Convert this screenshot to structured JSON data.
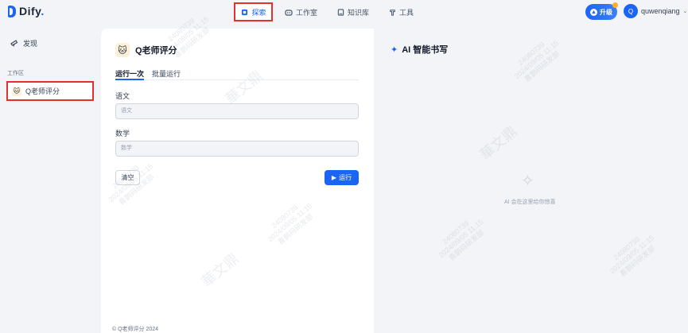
{
  "brand": {
    "name": "Dify",
    "dot": "."
  },
  "nav": [
    {
      "label": "探索",
      "icon": "compass-icon",
      "active": true
    },
    {
      "label": "工作室",
      "icon": "robot-icon",
      "active": false
    },
    {
      "label": "知识库",
      "icon": "book-icon",
      "active": false
    },
    {
      "label": "工具",
      "icon": "tool-icon",
      "active": false
    }
  ],
  "upgrade": {
    "label": "升级"
  },
  "user": {
    "initial": "Q",
    "name": "quwenqiang"
  },
  "sidebar": {
    "discover": "发现",
    "section": "工作区",
    "app": {
      "label": "Q老师评分",
      "icon": "robot-face-icon"
    }
  },
  "app": {
    "title": "Q老师评分",
    "tabs": [
      "运行一次",
      "批量运行"
    ],
    "fields": [
      {
        "label": "语文",
        "placeholder": "语文"
      },
      {
        "label": "数学",
        "placeholder": "数学"
      }
    ],
    "clear_label": "清空",
    "run_label": "运行",
    "footer": "© Q老师评分 2024"
  },
  "right": {
    "title": "AI 智能书写",
    "empty_text": "AI 会在这里给你惊喜"
  },
  "watermark": {
    "id": "24080739",
    "date": "2024/09/05 11:15",
    "org": "喜鹊码研发部",
    "big": "華文鼎"
  },
  "colors": {
    "accent": "#1c64f2",
    "highlight": "#e4322b"
  }
}
